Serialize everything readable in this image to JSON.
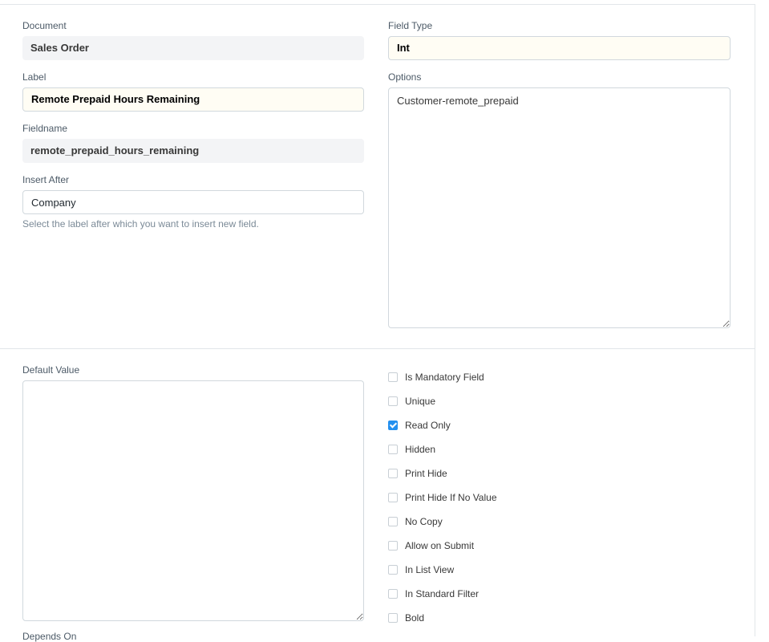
{
  "fields": {
    "document": {
      "label": "Document",
      "value": "Sales Order"
    },
    "label": {
      "label": "Label",
      "value": "Remote Prepaid Hours Remaining"
    },
    "fieldname": {
      "label": "Fieldname",
      "value": "remote_prepaid_hours_remaining"
    },
    "insert_after": {
      "label": "Insert After",
      "value": "Company",
      "help": "Select the label after which you want to insert new field."
    },
    "field_type": {
      "label": "Field Type",
      "value": "Int"
    },
    "options": {
      "label": "Options",
      "value": "Customer-remote_prepaid"
    },
    "default_value": {
      "label": "Default Value",
      "value": ""
    },
    "cut_label": "Depends On"
  },
  "checkboxes": [
    {
      "label": "Is Mandatory Field",
      "checked": false
    },
    {
      "label": "Unique",
      "checked": false
    },
    {
      "label": "Read Only",
      "checked": true
    },
    {
      "label": "Hidden",
      "checked": false
    },
    {
      "label": "Print Hide",
      "checked": false
    },
    {
      "label": "Print Hide If No Value",
      "checked": false
    },
    {
      "label": "No Copy",
      "checked": false
    },
    {
      "label": "Allow on Submit",
      "checked": false
    },
    {
      "label": "In List View",
      "checked": false
    },
    {
      "label": "In Standard Filter",
      "checked": false
    },
    {
      "label": "Bold",
      "checked": false
    }
  ],
  "colors": {
    "accent": "#2490ef",
    "input_bg": "#f3f4f6",
    "highlight_bg": "#fffdf4"
  }
}
